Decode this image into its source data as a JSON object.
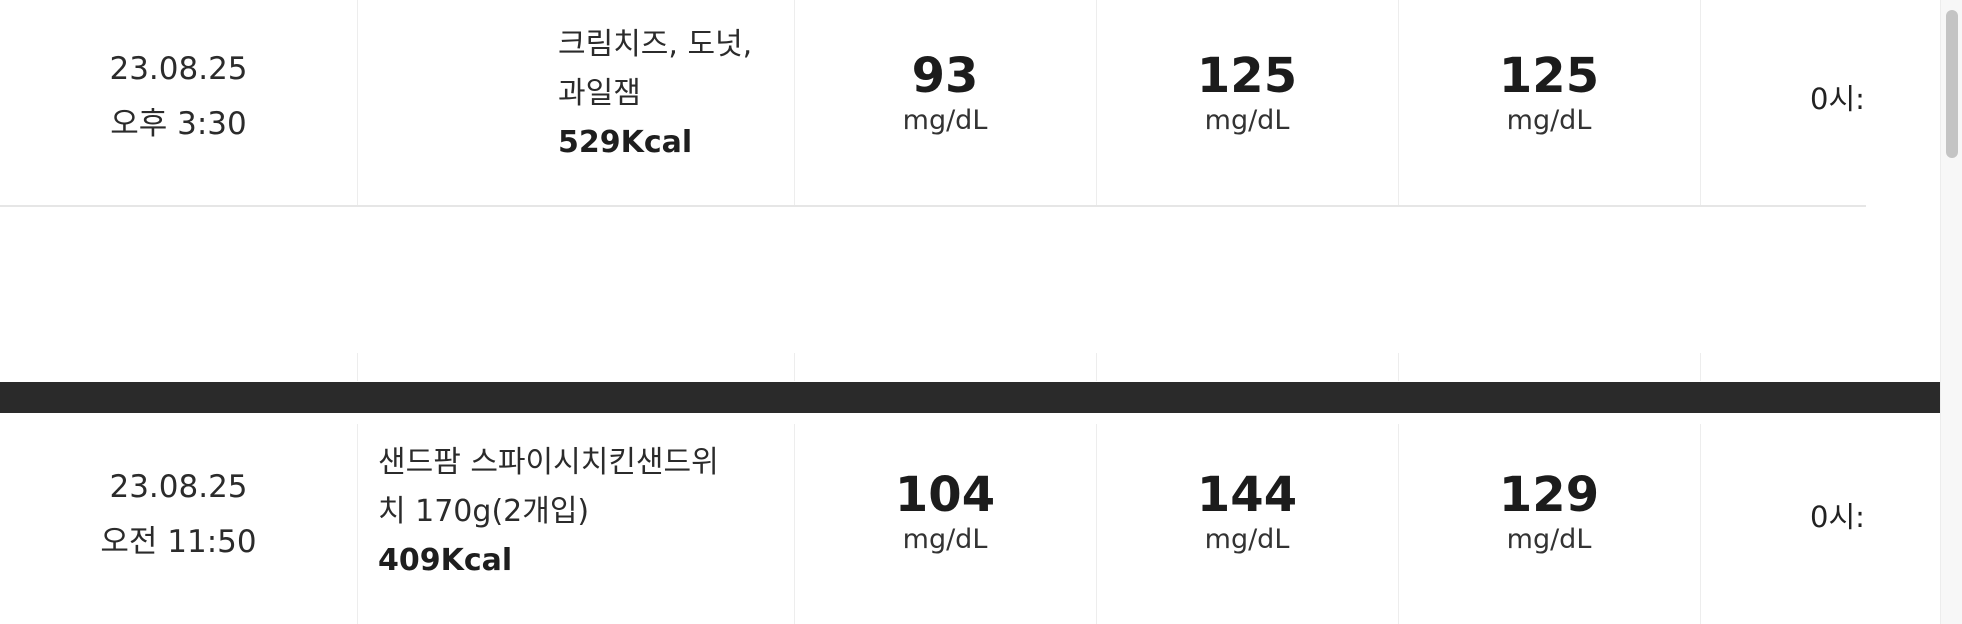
{
  "records": [
    {
      "date": "23.08.25",
      "time": "오후 3:30",
      "food_line1": "크림치즈, 도넛,",
      "food_line2": "과일잼",
      "kcal": "529Kcal",
      "v1": "93",
      "v2": "125",
      "v3": "125",
      "unit": "mg/dL",
      "last": "0시:"
    },
    {
      "date": "23.08.25",
      "time": "오전 11:50",
      "food_line1": "샌드팜 스파이시치킨샌드위",
      "food_line2": "치 170g(2개입)",
      "kcal": "409Kcal",
      "v1": "104",
      "v2": "144",
      "v3": "129",
      "unit": "mg/dL",
      "last": "0시:"
    }
  ]
}
